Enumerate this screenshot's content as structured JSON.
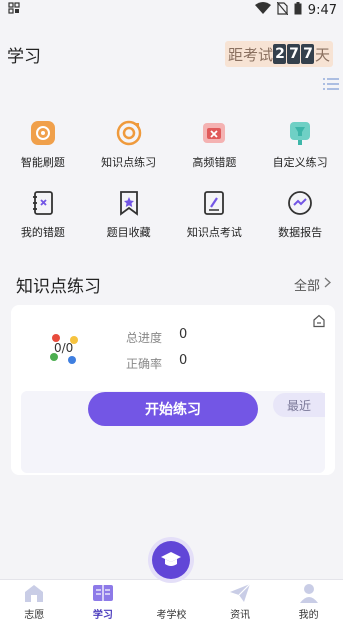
{
  "status": {
    "time": "9:47"
  },
  "header": {
    "title": "学习",
    "countdown_prefix": "距考试",
    "countdown_digits": [
      "2",
      "7",
      "7"
    ],
    "countdown_suffix": "天"
  },
  "grid": [
    {
      "label": "智能刷题",
      "icon": "smart-practice-icon",
      "color": "#e98f2f"
    },
    {
      "label": "知识点练习",
      "icon": "knowledge-practice-icon",
      "color": "#e98f2f"
    },
    {
      "label": "高频错题",
      "icon": "frequent-mistakes-icon",
      "color": "#e05a5a"
    },
    {
      "label": "自定义练习",
      "icon": "custom-practice-icon",
      "color": "#3db6a9"
    },
    {
      "label": "我的错题",
      "icon": "my-mistakes-icon",
      "color": "#333"
    },
    {
      "label": "题目收藏",
      "icon": "favorites-icon",
      "color": "#333"
    },
    {
      "label": "知识点考试",
      "icon": "knowledge-exam-icon",
      "color": "#333"
    },
    {
      "label": "数据报告",
      "icon": "data-report-icon",
      "color": "#333"
    }
  ],
  "section": {
    "title": "知识点练习",
    "see_all": "全部"
  },
  "card": {
    "progress": "0/0",
    "total_progress_label": "总进度",
    "total_progress_value": "0",
    "accuracy_label": "正确率",
    "accuracy_value": "0",
    "start_button": "开始练习",
    "recent_tag": "最近"
  },
  "tabs": [
    {
      "label": "志愿",
      "icon": "volunteer-icon"
    },
    {
      "label": "学习",
      "icon": "study-icon",
      "active": true
    },
    {
      "label": "考学校",
      "icon": "graduation-cap-icon"
    },
    {
      "label": "资讯",
      "icon": "news-icon"
    },
    {
      "label": "我的",
      "icon": "profile-icon"
    }
  ],
  "colors": {
    "accent": "#7356e5",
    "tab_active": "#4a3bbd"
  }
}
